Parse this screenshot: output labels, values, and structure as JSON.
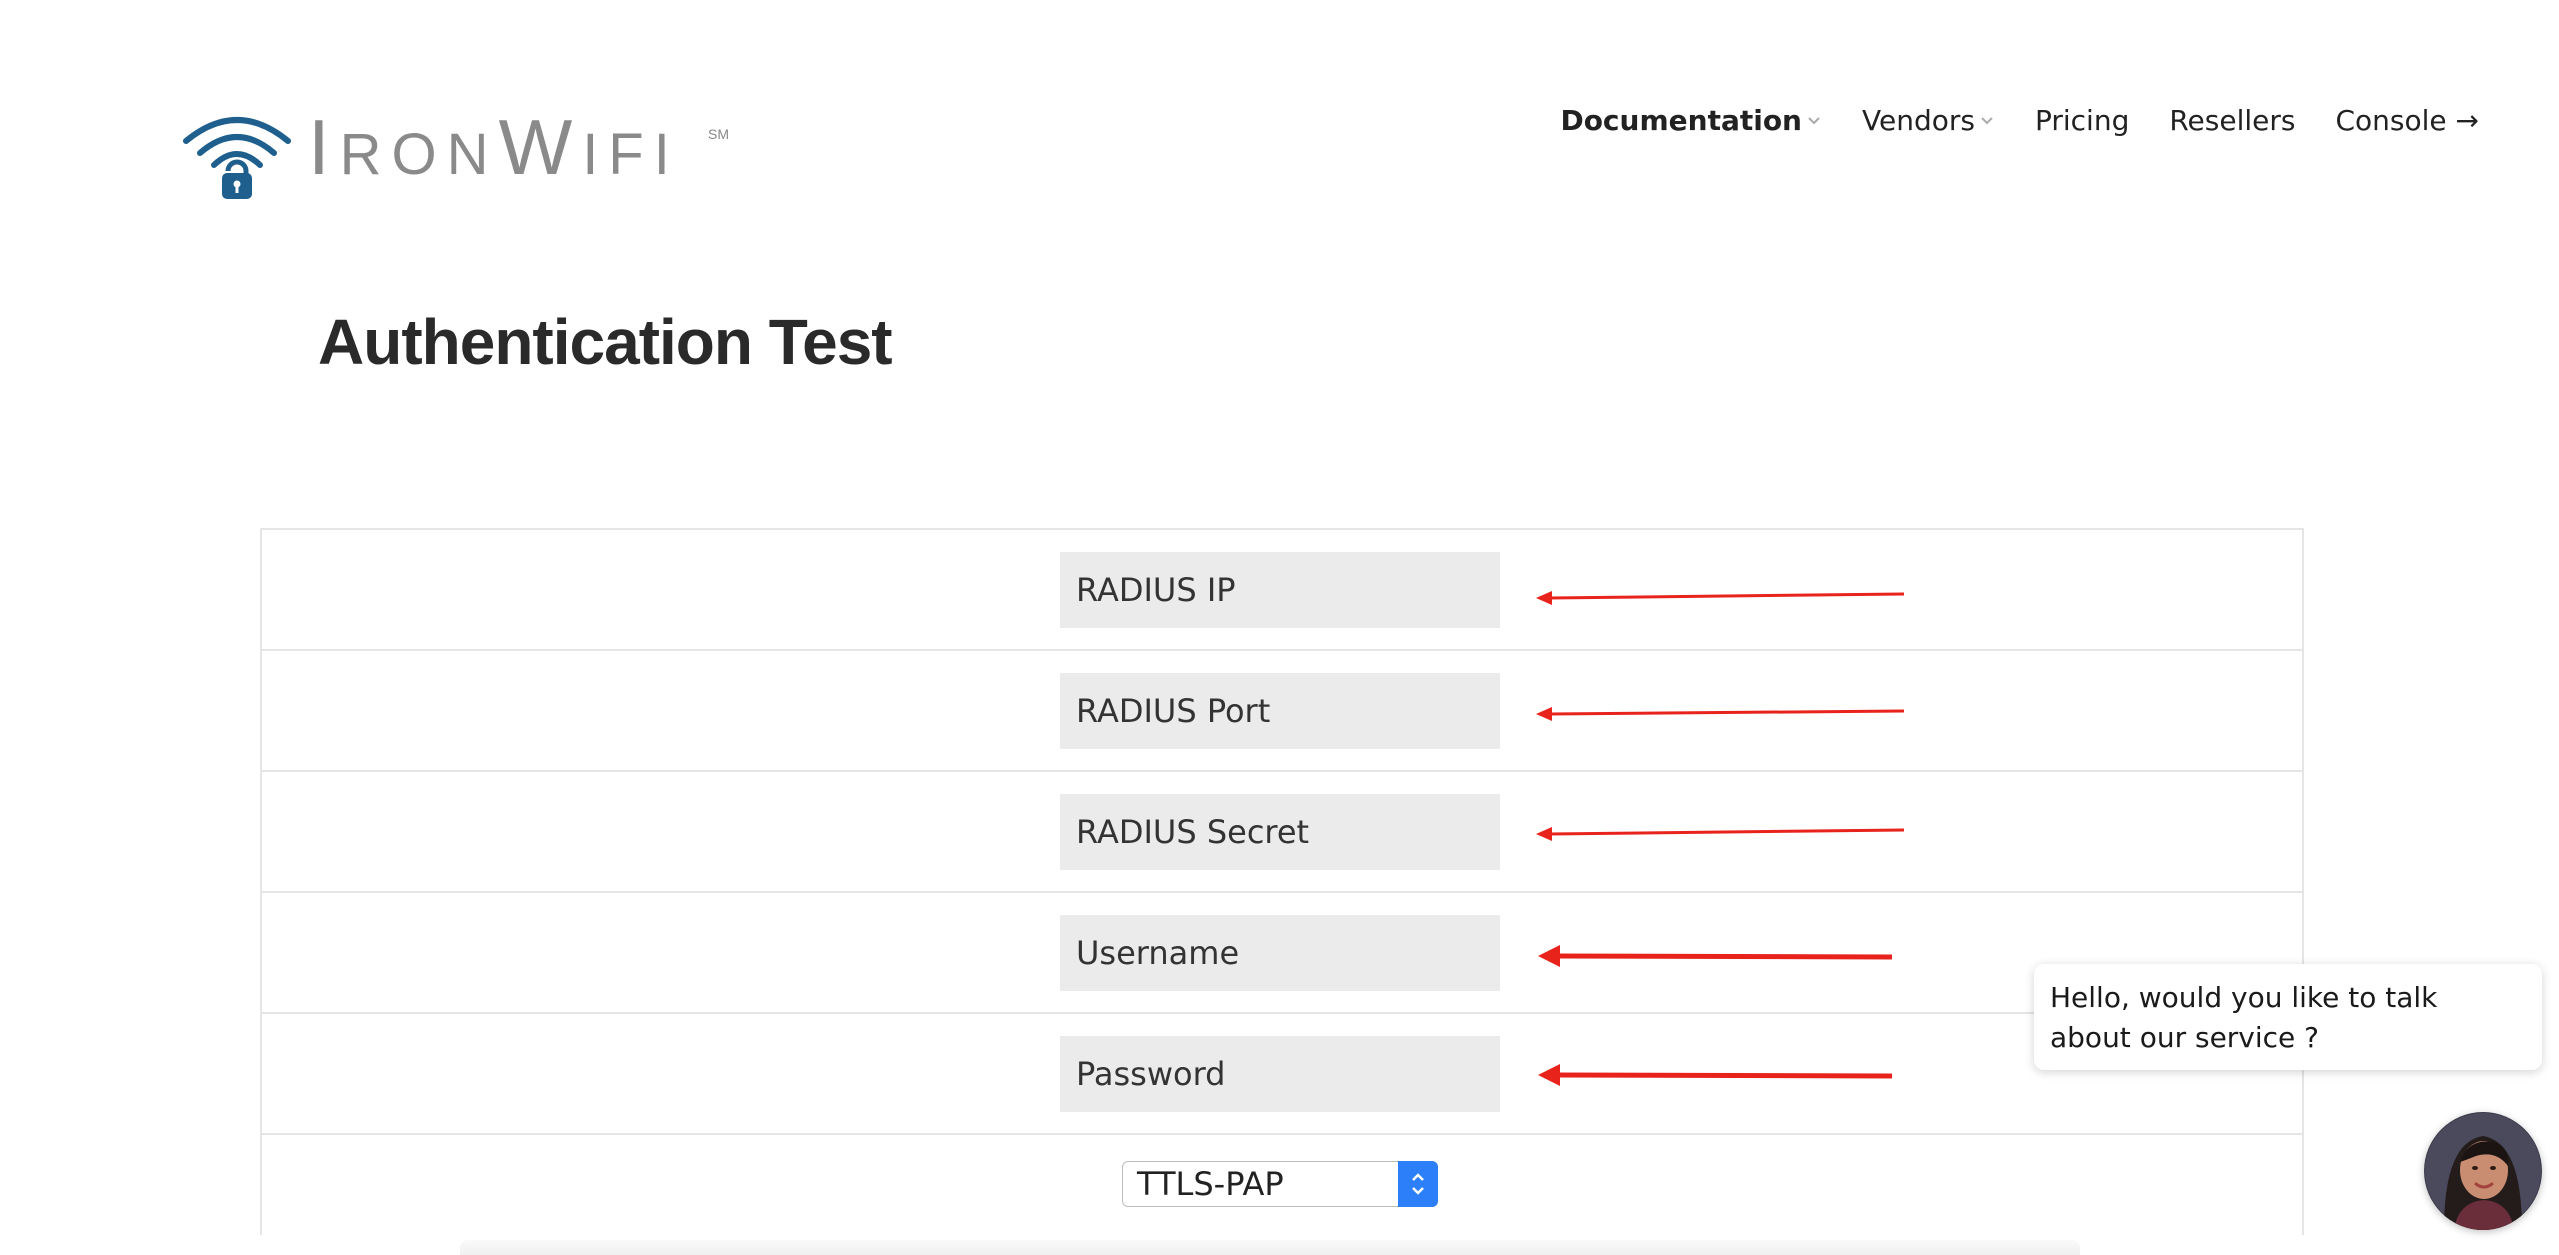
{
  "brand": {
    "name_parts": [
      "I",
      "RON",
      "W",
      "IFI"
    ],
    "service_mark": "SM"
  },
  "nav": {
    "items": [
      {
        "label": "Documentation",
        "dropdown": true,
        "bold": true
      },
      {
        "label": "Vendors",
        "dropdown": true,
        "bold": false
      },
      {
        "label": "Pricing",
        "dropdown": false,
        "bold": false
      },
      {
        "label": "Resellers",
        "dropdown": false,
        "bold": false
      },
      {
        "label": "Console →",
        "dropdown": false,
        "bold": false
      }
    ]
  },
  "page": {
    "title": "Authentication Test"
  },
  "form": {
    "fields": [
      {
        "placeholder": "RADIUS IP",
        "value": ""
      },
      {
        "placeholder": "RADIUS Port",
        "value": ""
      },
      {
        "placeholder": "RADIUS Secret",
        "value": ""
      },
      {
        "placeholder": "Username",
        "value": ""
      },
      {
        "placeholder": "Password",
        "value": ""
      }
    ],
    "method": {
      "selected": "TTLS-PAP"
    }
  },
  "chat": {
    "message": "Hello, would you like to talk about our service ?"
  },
  "colors": {
    "accent_blue": "#2d7ff9",
    "logo_blue": "#1f5f8e",
    "annotation_red": "#e8231c",
    "logo_gray": "#8a8a8a"
  },
  "icons": {
    "logo": "wifi-lock-icon",
    "chevron": "chevron-down-icon",
    "select": "up-down-chevron-icon",
    "arrow": "red-arrow-left-icon"
  }
}
